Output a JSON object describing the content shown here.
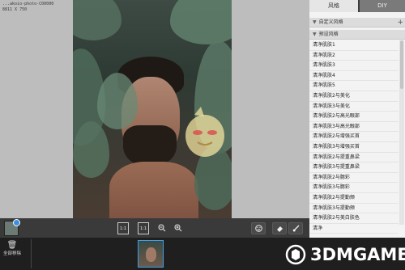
{
  "file_info": {
    "name": "...akoio-photo-C00000",
    "size": "8811 X 750"
  },
  "panel": {
    "tabs": [
      {
        "label": "风格",
        "active": true
      },
      {
        "label": "DIY",
        "active": false
      }
    ],
    "custom_group": "自定义风格",
    "preset_group": "预设风格",
    "presets": [
      "清净肌肤1",
      "清净肌肤2",
      "清净肌肤3",
      "清净肌肤4",
      "清净肌肤5",
      "清净肌肤2与美化",
      "清净肌肤3与美化",
      "清净肌肤2与高光眼部",
      "清净肌肤3与高光眼部",
      "清净肌肤2与增强买首",
      "清净肌肤3与增强买首",
      "清净肌肤2与提重鼻梁",
      "清净肌肤3与提重鼻梁",
      "清净肌肤2与腮彩",
      "清净肌肤3与腮彩",
      "清净肌肤2与提勤颊",
      "清净肌肤3与提勤颊",
      "清净肌肤2与美白肤色",
      "清净"
    ]
  },
  "viewer_toolbar": {
    "actual_size_label": "1:1",
    "fit_label": "1:1"
  },
  "film": {
    "remove_all": "全部移除"
  },
  "watermark": {
    "text": "3DMGAME"
  },
  "colors": {
    "accent": "#3aa0e8",
    "panel_bg": "#f3f3f3",
    "viewer_bg": "#bdbdbd",
    "film_bg": "#1f1f1f"
  }
}
